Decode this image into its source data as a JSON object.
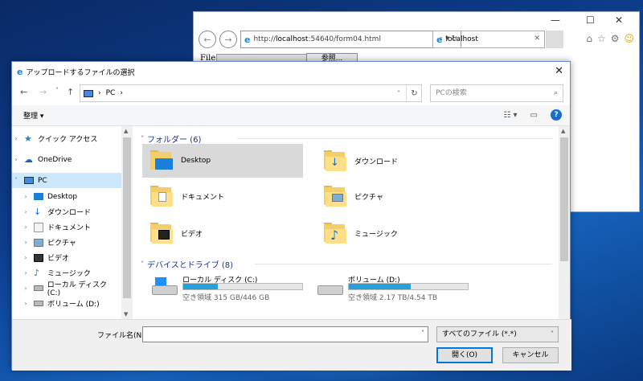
{
  "browser": {
    "url_prefix": "http://",
    "url_host": "localhost",
    "url_rest": ":54640/form04.html",
    "tab_title": "localhost",
    "page": {
      "file_label": "File",
      "browse_button": "参照..."
    }
  },
  "dialog": {
    "title": "アップロードするファイルの選択",
    "breadcrumb": [
      "PC",
      "›"
    ],
    "search_placeholder": "PCの検索",
    "organize_label": "整理 ▾",
    "sidebar": [
      {
        "label": "クイック アクセス",
        "icon": "star-icon"
      },
      {
        "label": "OneDrive",
        "icon": "cloud-icon"
      },
      {
        "label": "PC",
        "icon": "computer-icon",
        "selected": true
      },
      {
        "label": "Desktop",
        "icon": "desktop-icon"
      },
      {
        "label": "ダウンロード",
        "icon": "download-icon"
      },
      {
        "label": "ドキュメント",
        "icon": "document-icon"
      },
      {
        "label": "ピクチャ",
        "icon": "picture-icon"
      },
      {
        "label": "ビデオ",
        "icon": "video-icon"
      },
      {
        "label": "ミュージック",
        "icon": "music-icon"
      },
      {
        "label": "ローカル ディスク (C:)",
        "icon": "drive-icon"
      },
      {
        "label": "ボリューム (D:)",
        "icon": "drive-icon"
      }
    ],
    "folders_group": "フォルダー (6)",
    "folders": [
      {
        "label": "Desktop",
        "icon": "desktop-folder-icon",
        "selected": true
      },
      {
        "label": "ダウンロード",
        "icon": "download-folder-icon"
      },
      {
        "label": "ドキュメント",
        "icon": "document-folder-icon"
      },
      {
        "label": "ピクチャ",
        "icon": "picture-folder-icon"
      },
      {
        "label": "ビデオ",
        "icon": "video-folder-icon"
      },
      {
        "label": "ミュージック",
        "icon": "music-folder-icon"
      }
    ],
    "drives_group": "デバイスとドライブ (8)",
    "drives": [
      {
        "label": "ローカル ディスク (C:)",
        "free_text": "空き領域 315 GB/446 GB",
        "used_fraction": 0.29,
        "bar_color": "#26a0da"
      },
      {
        "label": "ボリューム (D:)",
        "free_text": "空き領域 2.17 TB/4.54 TB",
        "used_fraction": 0.52,
        "bar_color": "#26a0da"
      }
    ],
    "filename_label": "ファイル名(N):",
    "filename_value": "",
    "filter_value": "すべてのファイル (*.*)",
    "open_button": "開く(O)",
    "cancel_button": "キャンセル"
  }
}
